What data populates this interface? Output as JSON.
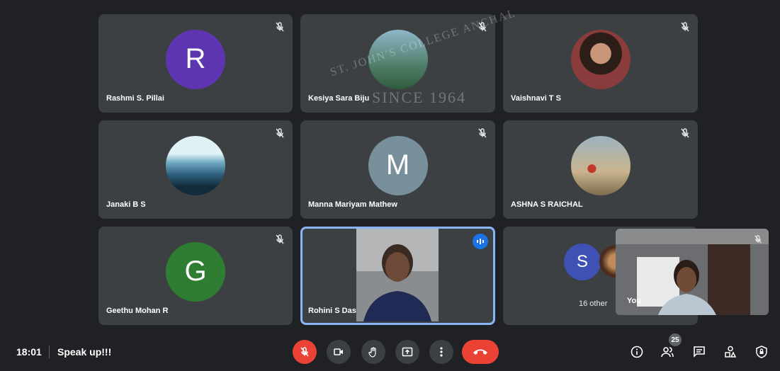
{
  "participants": [
    {
      "name": "Rashmi S. Pillai",
      "initial": "R",
      "avatar_color": "#5e35b1"
    },
    {
      "name": "Kesiya Sara Biju"
    },
    {
      "name": "Vaishnavi T S"
    },
    {
      "name": "Janaki B S"
    },
    {
      "name": "Manna Mariyam Mathew",
      "initial": "M",
      "avatar_color": "#78909c"
    },
    {
      "name": "ASHNA S RAICHAL"
    },
    {
      "name": "Geethu Mohan R",
      "initial": "G",
      "avatar_color": "#2e7d32"
    },
    {
      "name": "Rohini S Das",
      "speaking": true
    }
  ],
  "others_tile": {
    "initial": "S",
    "avatar_color": "#3f51b5",
    "label": "16 other"
  },
  "self_view": {
    "label": "You"
  },
  "watermark": {
    "line1": "ST. JOHN'S COLLEGE ANCHAL",
    "line2": "SINCE 1964"
  },
  "bottom_bar": {
    "time": "18:01",
    "meeting_name": "Speak up!!!",
    "participant_count": "25",
    "colors": {
      "end_call": "#ea4335",
      "mic_off": "#ea4335",
      "speaking": "#1a73e8"
    }
  }
}
